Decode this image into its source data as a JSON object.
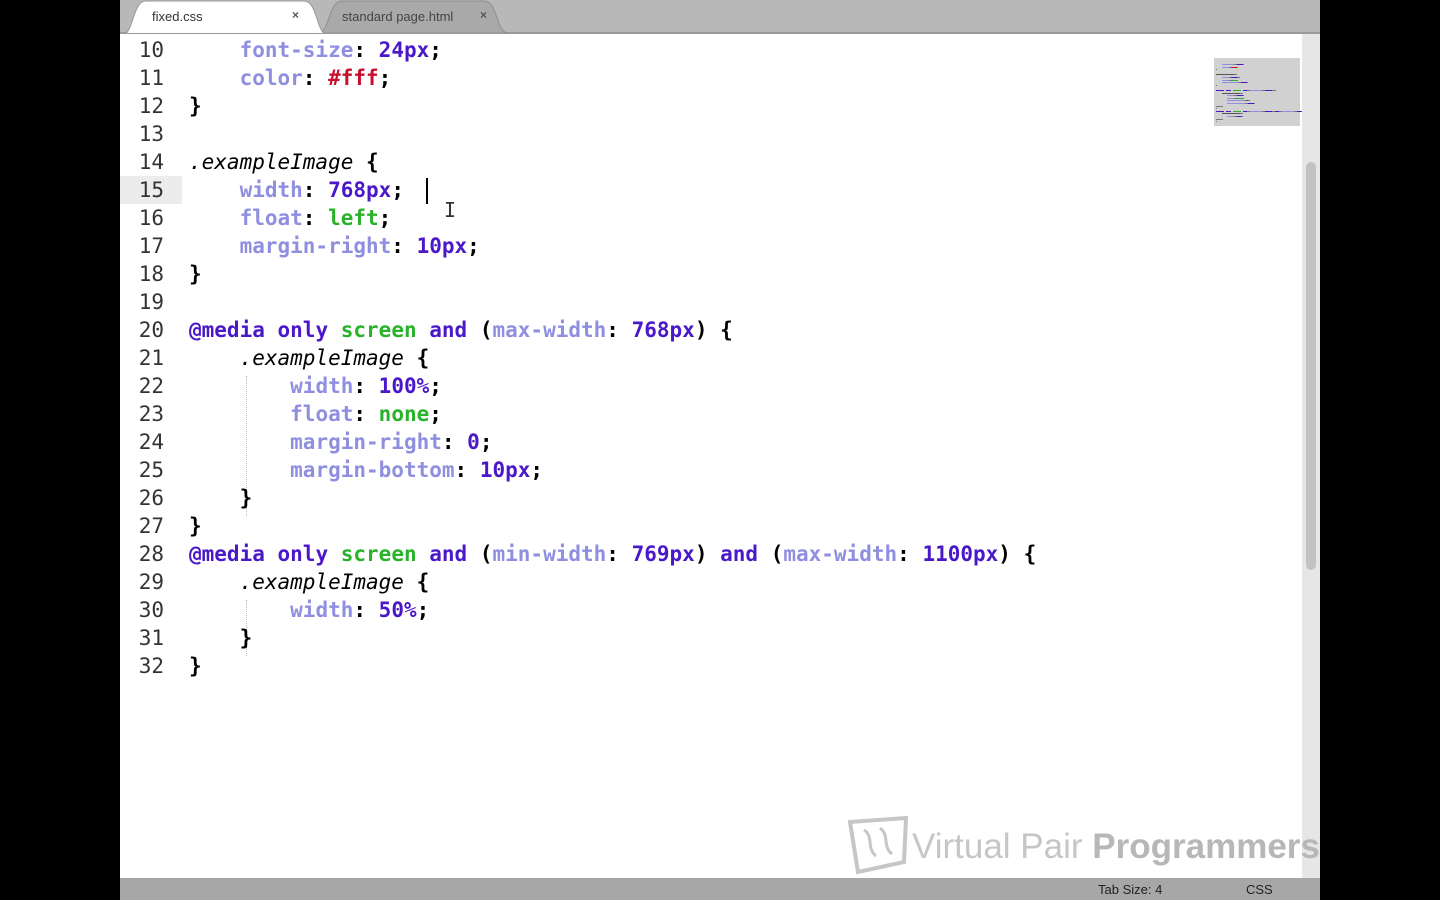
{
  "tabs": [
    {
      "label": "fixed.css",
      "active": true,
      "close": "×"
    },
    {
      "label": "standard page.html",
      "active": false,
      "close": "×"
    }
  ],
  "editor": {
    "current_line": "15",
    "line_numbers": [
      "10",
      "11",
      "12",
      "13",
      "14",
      "15",
      "16",
      "17",
      "18",
      "19",
      "20",
      "21",
      "22",
      "23",
      "24",
      "25",
      "26",
      "27",
      "28",
      "29",
      "30",
      "31",
      "32"
    ],
    "lines": [
      [
        {
          "t": "    ",
          "c": "plain"
        },
        {
          "t": "font-size",
          "c": "prop"
        },
        {
          "t": ": ",
          "c": "plain"
        },
        {
          "t": "24px",
          "c": "num"
        },
        {
          "t": ";",
          "c": "plain"
        }
      ],
      [
        {
          "t": "    ",
          "c": "plain"
        },
        {
          "t": "color",
          "c": "prop"
        },
        {
          "t": ": ",
          "c": "plain"
        },
        {
          "t": "#fff",
          "c": "hex"
        },
        {
          "t": ";",
          "c": "plain"
        }
      ],
      [
        {
          "t": "}",
          "c": "plain"
        }
      ],
      [],
      [
        {
          "t": ".exampleImage",
          "c": "sel"
        },
        {
          "t": " {",
          "c": "plain"
        }
      ],
      [
        {
          "t": "    ",
          "c": "plain"
        },
        {
          "t": "width",
          "c": "prop"
        },
        {
          "t": ": ",
          "c": "plain"
        },
        {
          "t": "768px",
          "c": "num"
        },
        {
          "t": ";",
          "c": "plain"
        }
      ],
      [
        {
          "t": "    ",
          "c": "plain"
        },
        {
          "t": "float",
          "c": "prop"
        },
        {
          "t": ": ",
          "c": "plain"
        },
        {
          "t": "left",
          "c": "kwv"
        },
        {
          "t": ";",
          "c": "plain"
        }
      ],
      [
        {
          "t": "    ",
          "c": "plain"
        },
        {
          "t": "margin-right",
          "c": "prop"
        },
        {
          "t": ": ",
          "c": "plain"
        },
        {
          "t": "10px",
          "c": "num"
        },
        {
          "t": ";",
          "c": "plain"
        }
      ],
      [
        {
          "t": "}",
          "c": "plain"
        }
      ],
      [],
      [
        {
          "t": "@media",
          "c": "at"
        },
        {
          "t": " ",
          "c": "plain"
        },
        {
          "t": "only",
          "c": "at"
        },
        {
          "t": " ",
          "c": "plain"
        },
        {
          "t": "screen",
          "c": "kwv"
        },
        {
          "t": " ",
          "c": "plain"
        },
        {
          "t": "and",
          "c": "at"
        },
        {
          "t": " (",
          "c": "plain"
        },
        {
          "t": "max-width",
          "c": "prop"
        },
        {
          "t": ": ",
          "c": "plain"
        },
        {
          "t": "768px",
          "c": "num"
        },
        {
          "t": ") {",
          "c": "plain"
        }
      ],
      [
        {
          "t": "    ",
          "c": "plain"
        },
        {
          "t": ".exampleImage",
          "c": "sel"
        },
        {
          "t": " {",
          "c": "plain"
        }
      ],
      [
        {
          "t": "        ",
          "c": "plain"
        },
        {
          "t": "width",
          "c": "prop"
        },
        {
          "t": ": ",
          "c": "plain"
        },
        {
          "t": "100%",
          "c": "num"
        },
        {
          "t": ";",
          "c": "plain"
        }
      ],
      [
        {
          "t": "        ",
          "c": "plain"
        },
        {
          "t": "float",
          "c": "prop"
        },
        {
          "t": ": ",
          "c": "plain"
        },
        {
          "t": "none",
          "c": "kwv"
        },
        {
          "t": ";",
          "c": "plain"
        }
      ],
      [
        {
          "t": "        ",
          "c": "plain"
        },
        {
          "t": "margin-right",
          "c": "prop"
        },
        {
          "t": ": ",
          "c": "plain"
        },
        {
          "t": "0",
          "c": "num"
        },
        {
          "t": ";",
          "c": "plain"
        }
      ],
      [
        {
          "t": "        ",
          "c": "plain"
        },
        {
          "t": "margin-bottom",
          "c": "prop"
        },
        {
          "t": ": ",
          "c": "plain"
        },
        {
          "t": "10px",
          "c": "num"
        },
        {
          "t": ";",
          "c": "plain"
        }
      ],
      [
        {
          "t": "    }",
          "c": "plain"
        }
      ],
      [
        {
          "t": "}",
          "c": "plain"
        }
      ],
      [
        {
          "t": "@media",
          "c": "at"
        },
        {
          "t": " ",
          "c": "plain"
        },
        {
          "t": "only",
          "c": "at"
        },
        {
          "t": " ",
          "c": "plain"
        },
        {
          "t": "screen",
          "c": "kwv"
        },
        {
          "t": " ",
          "c": "plain"
        },
        {
          "t": "and",
          "c": "at"
        },
        {
          "t": " (",
          "c": "plain"
        },
        {
          "t": "min-width",
          "c": "prop"
        },
        {
          "t": ": ",
          "c": "plain"
        },
        {
          "t": "769px",
          "c": "num"
        },
        {
          "t": ") ",
          "c": "plain"
        },
        {
          "t": "and",
          "c": "at"
        },
        {
          "t": " (",
          "c": "plain"
        },
        {
          "t": "max-width",
          "c": "prop"
        },
        {
          "t": ": ",
          "c": "plain"
        },
        {
          "t": "1100px",
          "c": "num"
        },
        {
          "t": ") {",
          "c": "plain"
        }
      ],
      [
        {
          "t": "    ",
          "c": "plain"
        },
        {
          "t": ".exampleImage",
          "c": "sel"
        },
        {
          "t": " {",
          "c": "plain"
        }
      ],
      [
        {
          "t": "        ",
          "c": "plain"
        },
        {
          "t": "width",
          "c": "prop"
        },
        {
          "t": ": ",
          "c": "plain"
        },
        {
          "t": "50%",
          "c": "num"
        },
        {
          "t": ";",
          "c": "plain"
        }
      ],
      [
        {
          "t": "    }",
          "c": "plain"
        }
      ],
      [
        {
          "t": "}",
          "c": "plain"
        }
      ]
    ]
  },
  "watermark": {
    "light": "Virtual Pair ",
    "bold": "Programmers"
  },
  "status": {
    "tab_size": "Tab Size: 4",
    "syntax": "CSS"
  },
  "colors": {
    "property": "#8f8fe0",
    "number": "#4a18c8",
    "hex": "#c8102e",
    "value_keyword": "#2ab22a",
    "at_rule": "#4a18c8"
  }
}
